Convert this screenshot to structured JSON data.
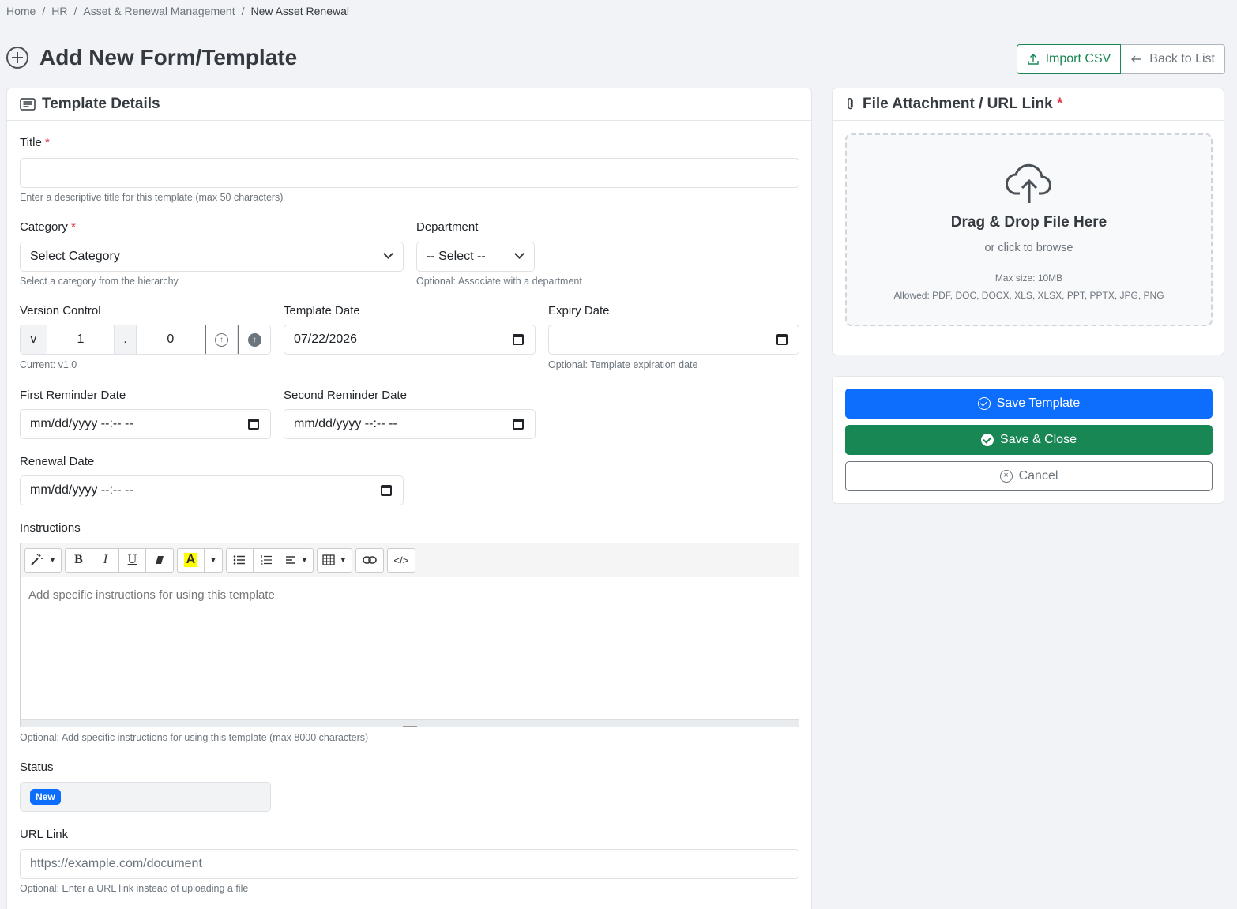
{
  "breadcrumb": {
    "items": [
      "Home",
      "HR",
      "Asset & Renewal Management"
    ],
    "current": "New Asset Renewal",
    "separator": "/"
  },
  "page": {
    "title": "Add New Form/Template"
  },
  "header_actions": {
    "import_label": "Import CSV",
    "back_label": "Back to List"
  },
  "template_details": {
    "heading": "Template Details",
    "title_label": "Title",
    "title_value": "",
    "title_help": "Enter a descriptive title for this template (max 50 characters)",
    "category_label": "Category",
    "category_value": "Select Category",
    "category_help": "Select a category from the hierarchy",
    "department_label": "Department",
    "department_value": "-- Select --",
    "department_help": "Optional: Associate with a department",
    "version_label": "Version Control",
    "version_prefix": "v",
    "version_major": "1",
    "version_dot": ".",
    "version_minor": "0",
    "version_help": "Current: v1.0",
    "template_date_label": "Template Date",
    "template_date_value": "07/22/2026",
    "expiry_date_label": "Expiry Date",
    "expiry_date_value": "",
    "expiry_help": "Optional: Template expiration date",
    "first_reminder_label": "First Reminder Date",
    "first_reminder_value": "mm/dd/yyyy --:-- --",
    "second_reminder_label": "Second Reminder Date",
    "second_reminder_value": "mm/dd/yyyy --:-- --",
    "renewal_label": "Renewal Date",
    "renewal_value": "mm/dd/yyyy --:-- --",
    "instructions_label": "Instructions",
    "instructions_placeholder": "Add specific instructions for using this template",
    "instructions_help": "Optional: Add specific instructions for using this template (max 8000 characters)",
    "status_label": "Status",
    "status_badge": "New",
    "url_label": "URL Link",
    "url_placeholder": "https://example.com/document",
    "url_help": "Optional: Enter a URL link instead of uploading a file"
  },
  "toolbar": {
    "bold": "B",
    "italic": "I",
    "underline": "U",
    "highlight": "A",
    "code": "</>"
  },
  "attachment": {
    "heading": "File Attachment / URL Link",
    "drop_title": "Drag & Drop File Here",
    "drop_sub": "or click to browse",
    "max_size": "Max size: 10MB",
    "allowed": "Allowed: PDF, DOC, DOCX, XLS, XLSX, PPT, PPTX, JPG, PNG"
  },
  "actions": {
    "save_label": "Save Template",
    "save_close_label": "Save & Close",
    "cancel_label": "Cancel"
  },
  "colors": {
    "primary": "#0d6efd",
    "success": "#198754",
    "danger": "#dc3545",
    "secondary": "#6c757d"
  }
}
